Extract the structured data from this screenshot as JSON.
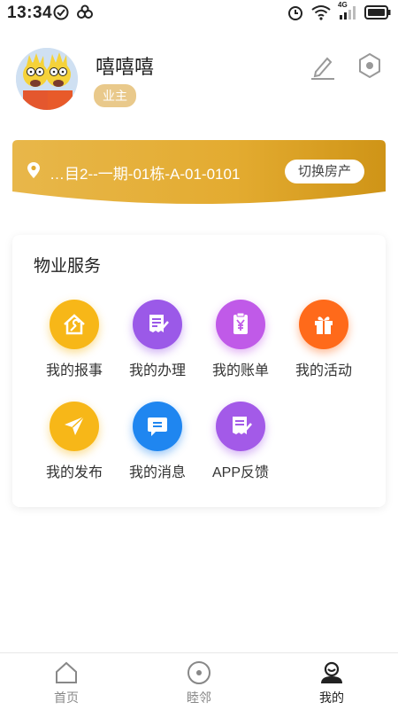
{
  "status_bar": {
    "time": "13:34",
    "network_label": "4G"
  },
  "profile": {
    "username": "嘻嘻嘻",
    "role_badge": "业主"
  },
  "address": {
    "text": "…目2--一期-01栋-A-01-0101",
    "switch_label": "切换房产"
  },
  "services": {
    "title": "物业服务",
    "items": [
      {
        "label": "我的报事",
        "icon": "house-wrench-icon",
        "color": "#f7b718"
      },
      {
        "label": "我的办理",
        "icon": "document-edit-icon",
        "color": "#9b59e8"
      },
      {
        "label": "我的账单",
        "icon": "bill-yen-icon",
        "color": "#c05ae8"
      },
      {
        "label": "我的活动",
        "icon": "gift-icon",
        "color": "#ff6a1a"
      },
      {
        "label": "我的发布",
        "icon": "paper-plane-icon",
        "color": "#f7b718"
      },
      {
        "label": "我的消息",
        "icon": "message-icon",
        "color": "#1f86f0"
      },
      {
        "label": "APP反馈",
        "icon": "feedback-icon",
        "color": "#a35ae8"
      }
    ]
  },
  "tabbar": {
    "tabs": [
      {
        "label": "首页",
        "icon": "home-icon",
        "active": false
      },
      {
        "label": "睦邻",
        "icon": "neighbor-icon",
        "active": false
      },
      {
        "label": "我的",
        "icon": "profile-icon",
        "active": true
      }
    ]
  },
  "colors": {
    "banner_gold": "#e0a62a",
    "badge_gold": "#e9c98b",
    "text_dark": "#222222",
    "tab_inactive": "#888888"
  }
}
